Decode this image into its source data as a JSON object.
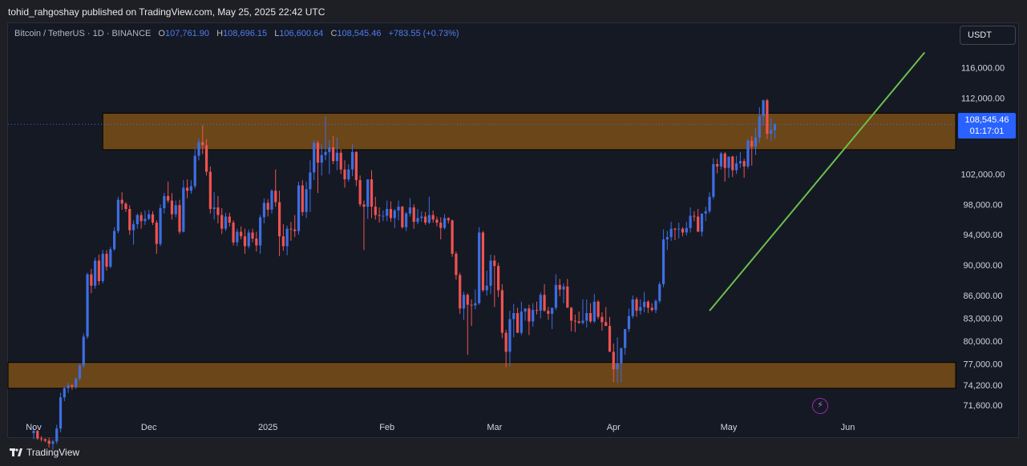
{
  "header": {
    "published": "tohid_rahgoshay published on TradingView.com, May 25, 2025 22:42 UTC"
  },
  "legend": {
    "symbol": "Bitcoin / TetherUS · 1D · BINANCE",
    "open_label": "O",
    "open": "107,761.90",
    "high_label": "H",
    "high": "108,696.15",
    "low_label": "L",
    "low": "106,600.64",
    "close_label": "C",
    "close": "108,545.46",
    "change": "+783.55 (+0.73%)"
  },
  "currency_button": "USDT",
  "last_price": {
    "price": "108,545.46",
    "countdown": "01:17:01"
  },
  "footer": {
    "brand": "TradingView"
  },
  "colors": {
    "up": "#3d6ee3",
    "down": "#ef5350",
    "zone": "#7a4f16",
    "trendline": "#6dbf4b",
    "last_price": "#2962ff"
  },
  "chart_data": {
    "type": "candlestick",
    "ylim": [
      70000,
      119000
    ],
    "y_ticks": [
      {
        "value": 116000,
        "label": "116,000.00"
      },
      {
        "value": 112000,
        "label": "112,000.00"
      },
      {
        "value": 102000,
        "label": "102,000.00"
      },
      {
        "value": 98000,
        "label": "98,000.00"
      },
      {
        "value": 94000,
        "label": "94,000.00"
      },
      {
        "value": 90000,
        "label": "90,000.00"
      },
      {
        "value": 86000,
        "label": "86,000.00"
      },
      {
        "value": 83000,
        "label": "83,000.00"
      },
      {
        "value": 80000,
        "label": "80,000.00"
      },
      {
        "value": 77000,
        "label": "77,000.00"
      },
      {
        "value": 74200,
        "label": "74,200.00"
      },
      {
        "value": 71600,
        "label": "71,600.00"
      }
    ],
    "x_ticks": [
      {
        "day": 0,
        "label": "Nov"
      },
      {
        "day": 30,
        "label": "Dec"
      },
      {
        "day": 61,
        "label": "2025"
      },
      {
        "day": 92,
        "label": "Feb"
      },
      {
        "day": 120,
        "label": "Mar"
      },
      {
        "day": 151,
        "label": "Apr"
      },
      {
        "day": 181,
        "label": "May"
      },
      {
        "day": 212,
        "label": "Jun"
      }
    ],
    "candles_start": "2024-10-28",
    "candles": [
      [
        67900,
        68600,
        67100,
        68200
      ],
      [
        68200,
        68300,
        67000,
        67200
      ],
      [
        67200,
        67500,
        66800,
        67100
      ],
      [
        67100,
        67200,
        66700,
        66900
      ],
      [
        66900,
        67300,
        66000,
        66500
      ],
      [
        66500,
        67000,
        65700,
        66800
      ],
      [
        66800,
        69000,
        66500,
        68500
      ],
      [
        68500,
        73200,
        68000,
        72600
      ],
      [
        72600,
        74000,
        72100,
        73800
      ],
      [
        73800,
        74500,
        73200,
        74200
      ],
      [
        74200,
        74400,
        73600,
        74000
      ],
      [
        74000,
        75200,
        73700,
        75100
      ],
      [
        75100,
        77000,
        74800,
        76800
      ],
      [
        76800,
        81000,
        76500,
        80600
      ],
      [
        80600,
        89000,
        80300,
        88800
      ],
      [
        88800,
        89500,
        86300,
        87300
      ],
      [
        87300,
        91000,
        86900,
        90600
      ],
      [
        90600,
        91400,
        87400,
        87900
      ],
      [
        87900,
        92000,
        87600,
        91500
      ],
      [
        91500,
        92000,
        89300,
        89800
      ],
      [
        89800,
        92400,
        89600,
        92100
      ],
      [
        92100,
        95000,
        91900,
        94500
      ],
      [
        94500,
        99000,
        94200,
        98600
      ],
      [
        98600,
        99600,
        97300,
        98100
      ],
      [
        98100,
        98300,
        97000,
        97400
      ],
      [
        97400,
        97900,
        94000,
        94600
      ],
      [
        94600,
        95900,
        92700,
        95400
      ],
      [
        95400,
        96800,
        94800,
        96600
      ],
      [
        96600,
        97000,
        94800,
        95800
      ],
      [
        95800,
        97200,
        95300,
        96100
      ],
      [
        96100,
        97300,
        95900,
        96700
      ],
      [
        96700,
        97100,
        95300,
        95600
      ],
      [
        95600,
        95900,
        91500,
        92800
      ],
      [
        92800,
        98000,
        92500,
        97500
      ],
      [
        97500,
        99500,
        96800,
        99100
      ],
      [
        99100,
        101000,
        98200,
        98500
      ],
      [
        98500,
        99500,
        96000,
        96700
      ],
      [
        96700,
        98500,
        96300,
        97900
      ],
      [
        97900,
        98600,
        94100,
        94400
      ],
      [
        94400,
        101200,
        94300,
        100200
      ],
      [
        100200,
        101300,
        98800,
        99800
      ],
      [
        99800,
        101200,
        99400,
        100400
      ],
      [
        100400,
        105300,
        100100,
        104400
      ],
      [
        104400,
        106700,
        103800,
        106200
      ],
      [
        106200,
        108400,
        104600,
        105800
      ],
      [
        105800,
        106600,
        101800,
        102300
      ],
      [
        102300,
        103000,
        96800,
        97400
      ],
      [
        97400,
        99600,
        96000,
        97600
      ],
      [
        97600,
        99100,
        95500,
        96600
      ],
      [
        96600,
        97500,
        94100,
        94800
      ],
      [
        94800,
        96900,
        94500,
        96400
      ],
      [
        96400,
        96900,
        95100,
        95600
      ],
      [
        95600,
        95900,
        92600,
        93000
      ],
      [
        93000,
        94800,
        92500,
        94400
      ],
      [
        94400,
        95100,
        93400,
        93800
      ],
      [
        93800,
        94800,
        91500,
        92500
      ],
      [
        92500,
        94700,
        92200,
        94300
      ],
      [
        94300,
        94800,
        93000,
        93500
      ],
      [
        93500,
        94400,
        91800,
        92600
      ],
      [
        92600,
        96600,
        91500,
        96300
      ],
      [
        96300,
        98800,
        95500,
        98200
      ],
      [
        98200,
        98700,
        96400,
        97300
      ],
      [
        97300,
        100000,
        96800,
        99800
      ],
      [
        99800,
        102600,
        97700,
        98300
      ],
      [
        98300,
        99800,
        91200,
        93800
      ],
      [
        93800,
        95400,
        91900,
        92500
      ],
      [
        92500,
        95200,
        91300,
        94800
      ],
      [
        94800,
        95700,
        93200,
        94700
      ],
      [
        94700,
        96600,
        93700,
        94500
      ],
      [
        94500,
        101000,
        94000,
        100500
      ],
      [
        100500,
        101200,
        96500,
        97000
      ],
      [
        97000,
        101000,
        96200,
        100000
      ],
      [
        100000,
        103800,
        97000,
        102200
      ],
      [
        102200,
        106500,
        101200,
        106100
      ],
      [
        106100,
        106400,
        99500,
        103500
      ],
      [
        103500,
        106000,
        101800,
        104500
      ],
      [
        104500,
        109600,
        103800,
        104900
      ],
      [
        104900,
        106500,
        102000,
        105500
      ],
      [
        105500,
        107000,
        103300,
        103700
      ],
      [
        103700,
        106800,
        102500,
        104800
      ],
      [
        104800,
        105300,
        102000,
        102600
      ],
      [
        102600,
        103800,
        100200,
        101300
      ],
      [
        101300,
        103300,
        101000,
        102600
      ],
      [
        102600,
        106000,
        101700,
        104900
      ],
      [
        104900,
        105000,
        100400,
        101200
      ],
      [
        101200,
        101800,
        97700,
        98000
      ],
      [
        98000,
        98500,
        92000,
        97700
      ],
      [
        97700,
        100700,
        96100,
        101300
      ],
      [
        101300,
        102500,
        96200,
        97700
      ],
      [
        97700,
        99000,
        96000,
        96600
      ],
      [
        96600,
        97600,
        95600,
        96500
      ],
      [
        96500,
        97200,
        95800,
        96500
      ],
      [
        96500,
        98500,
        95800,
        97400
      ],
      [
        97400,
        98400,
        95700,
        96200
      ],
      [
        96200,
        97400,
        94900,
        97200
      ],
      [
        97200,
        98500,
        95900,
        97700
      ],
      [
        97700,
        97800,
        94800,
        95000
      ],
      [
        95000,
        97000,
        94500,
        96800
      ],
      [
        96800,
        98800,
        96400,
        97600
      ],
      [
        97600,
        98000,
        94800,
        95700
      ],
      [
        95700,
        97400,
        95400,
        96200
      ],
      [
        96200,
        97100,
        95700,
        96400
      ],
      [
        96400,
        97000,
        95300,
        95600
      ],
      [
        95600,
        99000,
        95400,
        96600
      ],
      [
        96600,
        97200,
        95600,
        96000
      ],
      [
        96000,
        96400,
        95100,
        95600
      ],
      [
        95600,
        96300,
        93400,
        94900
      ],
      [
        94900,
        96700,
        94700,
        96200
      ],
      [
        96200,
        96300,
        95500,
        95900
      ],
      [
        95900,
        96000,
        91100,
        91500
      ],
      [
        91500,
        91800,
        88100,
        88700
      ],
      [
        88700,
        89000,
        83600,
        84300
      ],
      [
        84300,
        86500,
        82800,
        86100
      ],
      [
        86100,
        86300,
        78200,
        84800
      ],
      [
        84800,
        85500,
        82000,
        84700
      ],
      [
        84700,
        86800,
        84200,
        85000
      ],
      [
        85000,
        95000,
        84800,
        94300
      ],
      [
        94300,
        94500,
        86500,
        86700
      ],
      [
        86700,
        89300,
        86000,
        87300
      ],
      [
        87300,
        91400,
        86200,
        90600
      ],
      [
        90600,
        91300,
        84500,
        89900
      ],
      [
        89900,
        90300,
        85800,
        86700
      ],
      [
        86700,
        87500,
        80400,
        81100
      ],
      [
        81100,
        81500,
        76600,
        78600
      ],
      [
        78600,
        84000,
        76700,
        82900
      ],
      [
        82900,
        84900,
        80500,
        83700
      ],
      [
        83700,
        84400,
        81200,
        81100
      ],
      [
        81100,
        85200,
        80800,
        83900
      ],
      [
        83900,
        84100,
        82700,
        84300
      ],
      [
        84300,
        84800,
        80800,
        82600
      ],
      [
        82600,
        85000,
        81900,
        84100
      ],
      [
        84100,
        85200,
        83500,
        84000
      ],
      [
        84000,
        86400,
        83000,
        86100
      ],
      [
        86100,
        87500,
        83900,
        84000
      ],
      [
        84000,
        84500,
        82800,
        83600
      ],
      [
        83600,
        84200,
        81600,
        84400
      ],
      [
        84400,
        88800,
        84100,
        87400
      ],
      [
        87400,
        88200,
        85900,
        86800
      ],
      [
        86800,
        87600,
        85000,
        87200
      ],
      [
        87200,
        88200,
        85100,
        84400
      ],
      [
        84400,
        84500,
        81300,
        82700
      ],
      [
        82700,
        83500,
        81200,
        82600
      ],
      [
        82600,
        83900,
        82300,
        82400
      ],
      [
        82400,
        85500,
        82200,
        82700
      ],
      [
        82700,
        85500,
        81800,
        83700
      ],
      [
        83700,
        85000,
        82400,
        82600
      ],
      [
        82600,
        86200,
        82400,
        85200
      ],
      [
        85200,
        85400,
        82900,
        83200
      ],
      [
        83200,
        83800,
        81400,
        82500
      ],
      [
        82500,
        84500,
        82300,
        82000
      ],
      [
        82000,
        83200,
        81200,
        78600
      ],
      [
        78600,
        79700,
        74600,
        76300
      ],
      [
        76300,
        80500,
        74500,
        77100
      ],
      [
        77100,
        78100,
        74600,
        79100
      ],
      [
        79100,
        79600,
        78200,
        81600
      ],
      [
        81600,
        84300,
        81200,
        83300
      ],
      [
        83300,
        86000,
        83000,
        85500
      ],
      [
        85500,
        85800,
        83200,
        84000
      ],
      [
        84000,
        85500,
        83500,
        84500
      ],
      [
        84500,
        86500,
        83800,
        85200
      ],
      [
        85200,
        85400,
        83700,
        84400
      ],
      [
        84400,
        85000,
        83900,
        84100
      ],
      [
        84100,
        85500,
        83700,
        85300
      ],
      [
        85300,
        87800,
        85000,
        87500
      ],
      [
        87500,
        94700,
        87100,
        93400
      ],
      [
        93400,
        94500,
        92000,
        93700
      ],
      [
        93700,
        95700,
        93200,
        94800
      ],
      [
        94800,
        94900,
        93300,
        94700
      ],
      [
        94700,
        95600,
        93500,
        94800
      ],
      [
        94800,
        95000,
        93800,
        94300
      ],
      [
        94300,
        95700,
        93900,
        94900
      ],
      [
        94900,
        97600,
        94300,
        96500
      ],
      [
        96500,
        97100,
        95800,
        96400
      ],
      [
        96400,
        97400,
        94600,
        94400
      ],
      [
        94400,
        96500,
        93800,
        96800
      ],
      [
        96800,
        97700,
        95800,
        97100
      ],
      [
        97100,
        99600,
        96800,
        99000
      ],
      [
        99000,
        104100,
        98700,
        103300
      ],
      [
        103300,
        104000,
        102100,
        103000
      ],
      [
        103000,
        104900,
        102600,
        104700
      ],
      [
        104700,
        104900,
        101000,
        102800
      ],
      [
        102800,
        104300,
        101500,
        104300
      ],
      [
        104300,
        104400,
        101600,
        102500
      ],
      [
        102500,
        104400,
        102000,
        103400
      ],
      [
        103400,
        104900,
        102800,
        103700
      ],
      [
        103700,
        104000,
        101500,
        103000
      ],
      [
        103000,
        106600,
        102700,
        106400
      ],
      [
        106400,
        107000,
        103100,
        105600
      ],
      [
        105600,
        108000,
        104500,
        106800
      ],
      [
        106800,
        110800,
        106100,
        109600
      ],
      [
        109600,
        111800,
        108400,
        111700
      ],
      [
        111700,
        111900,
        106600,
        107300
      ],
      [
        107300,
        109400,
        106300,
        107800
      ],
      [
        107761.9,
        108696.15,
        106600.64,
        108545.46
      ]
    ],
    "zones": [
      {
        "from": 105200,
        "to": 110000,
        "label": ""
      },
      {
        "from": 73800,
        "to": 77200,
        "label": ""
      }
    ],
    "trendline": [
      {
        "day": 176,
        "value": 84000
      },
      {
        "day": 232,
        "value": 118000
      }
    ],
    "last_price_value": 108545.46
  }
}
